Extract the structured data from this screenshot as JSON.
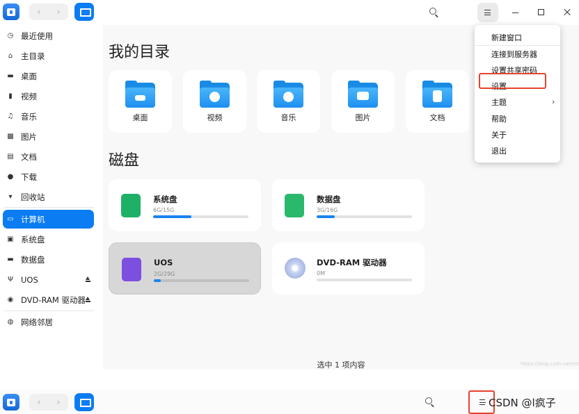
{
  "sidebar": {
    "items": [
      {
        "label": "最近使用",
        "icon": "clock-icon"
      },
      {
        "label": "主目录",
        "icon": "home-icon"
      },
      {
        "label": "桌面",
        "icon": "desktop-icon"
      },
      {
        "label": "视频",
        "icon": "video-icon"
      },
      {
        "label": "音乐",
        "icon": "music-icon"
      },
      {
        "label": "图片",
        "icon": "image-icon"
      },
      {
        "label": "文档",
        "icon": "document-icon"
      },
      {
        "label": "下载",
        "icon": "download-icon"
      },
      {
        "label": "回收站",
        "icon": "trash-icon"
      },
      {
        "label": "计算机",
        "icon": "computer-icon"
      },
      {
        "label": "系统盘",
        "icon": "disk-icon"
      },
      {
        "label": "数据盘",
        "icon": "disk-icon"
      },
      {
        "label": "UOS",
        "icon": "usb-icon"
      },
      {
        "label": "DVD-RAM 驱动器",
        "icon": "optical-disc-icon"
      },
      {
        "label": "网络邻居",
        "icon": "network-icon"
      }
    ]
  },
  "main": {
    "my_dirs_title": "我的目录",
    "dirs": [
      {
        "label": "桌面"
      },
      {
        "label": "视频"
      },
      {
        "label": "音乐"
      },
      {
        "label": "图片"
      },
      {
        "label": "文档"
      }
    ],
    "disks_title": "磁盘",
    "disks": [
      {
        "name": "系统盘",
        "size": "6G/15G",
        "usage": 0.4,
        "color": "#1fb068"
      },
      {
        "name": "数据盘",
        "size": "3G/16G",
        "usage": 0.19,
        "color": "#2ab86d"
      },
      {
        "name": "UOS",
        "size": "2G/29G",
        "usage": 0.07,
        "color": "#7d4fe0"
      },
      {
        "name": "DVD-RAM 驱动器",
        "size": "0M",
        "usage": 0,
        "color": "#9bb7e8"
      }
    ],
    "status": "选中 1 项内容",
    "watermark": "https://blog.csdn.net/m0_51..."
  },
  "menu": {
    "items": [
      "新建窗口",
      "连接到服务器",
      "设置共享密码",
      "设置",
      "主题",
      "帮助",
      "关于",
      "退出"
    ],
    "submenu_arrow": "›"
  },
  "bottom_watermark": "CSDN @l疯子",
  "colors": {
    "accent": "#0b7cf2",
    "highlight_box": "#e8412d"
  }
}
